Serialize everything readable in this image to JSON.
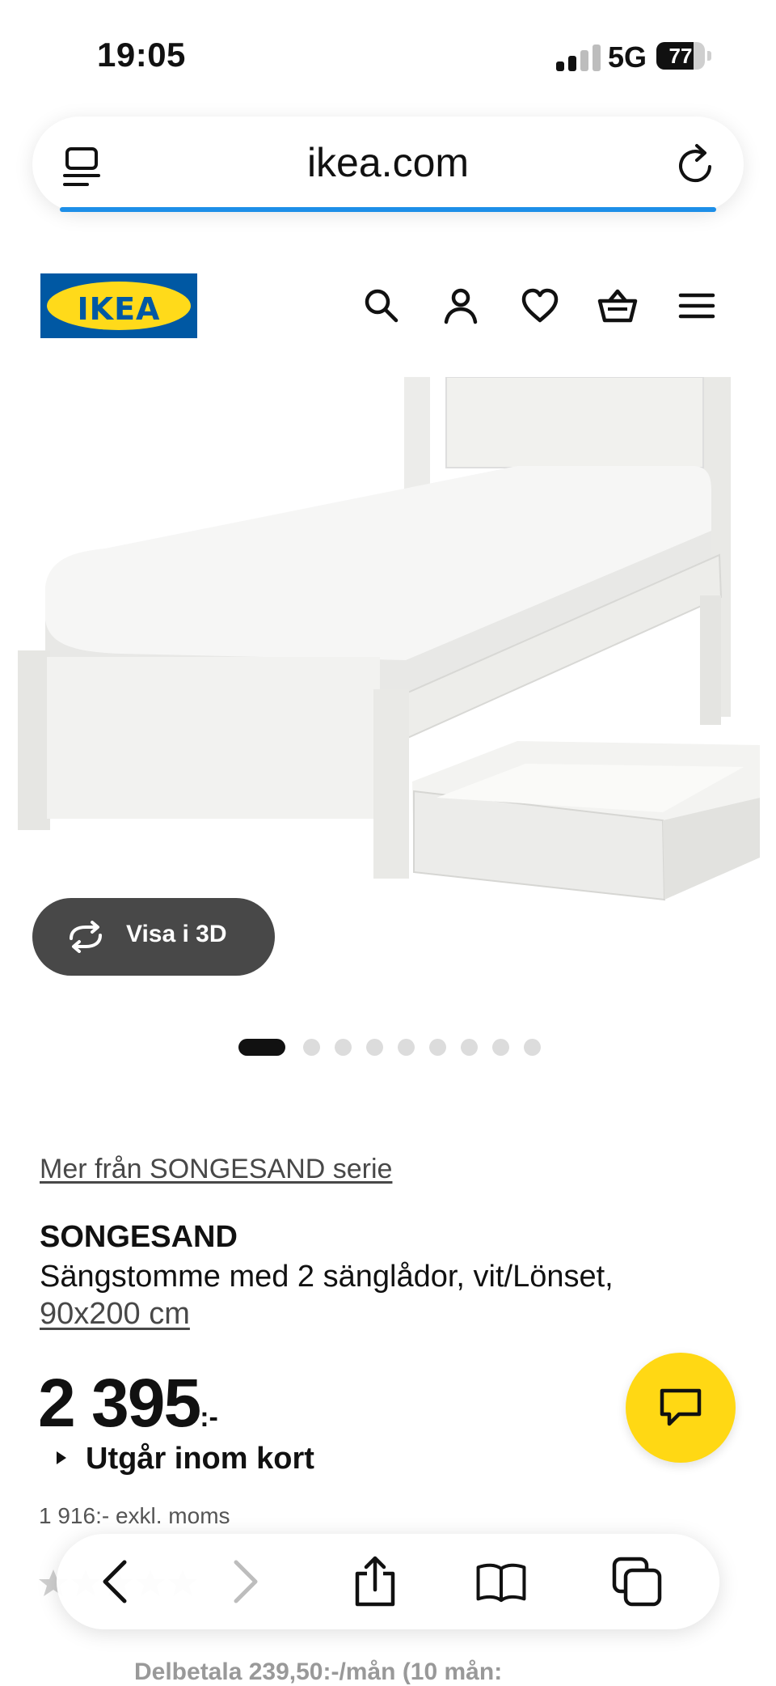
{
  "status_bar": {
    "time": "19:05",
    "network": "5G",
    "battery_percent": "77",
    "battery_level": 0.77
  },
  "browser": {
    "url": "ikea.com",
    "left_icon": "tab-list-icon",
    "right_icon": "reload-icon",
    "accent": "#1d8fe8"
  },
  "header": {
    "logo_text": "IKEA",
    "brand_blue": "#0058a3",
    "brand_yellow": "#ffda1a",
    "icons": [
      "search-icon",
      "account-icon",
      "heart-icon",
      "cart-icon",
      "menu-icon"
    ]
  },
  "gallery": {
    "view_3d_label": "Visa i 3D",
    "total_images": 9,
    "active_index": 0
  },
  "product": {
    "series_link": "Mer från SONGESAND serie",
    "name": "SONGESAND",
    "description": "Sängstomme med 2 sänglådor, vit/Lönset,",
    "size": "90x200 cm",
    "price_amount": "2 395",
    "price_suffix": ":-",
    "availability": "Utgår inom kort",
    "price_excl_vat": "1 916:- exkl. moms",
    "partial_payment": "Delbetala 239,50:-/mån (10 mån:"
  },
  "chat_button": {
    "icon": "chat-icon",
    "color": "#ffd814"
  },
  "toolbar": {
    "icons": [
      "back-icon",
      "forward-icon",
      "share-icon",
      "bookmarks-icon",
      "tabs-icon"
    ]
  }
}
